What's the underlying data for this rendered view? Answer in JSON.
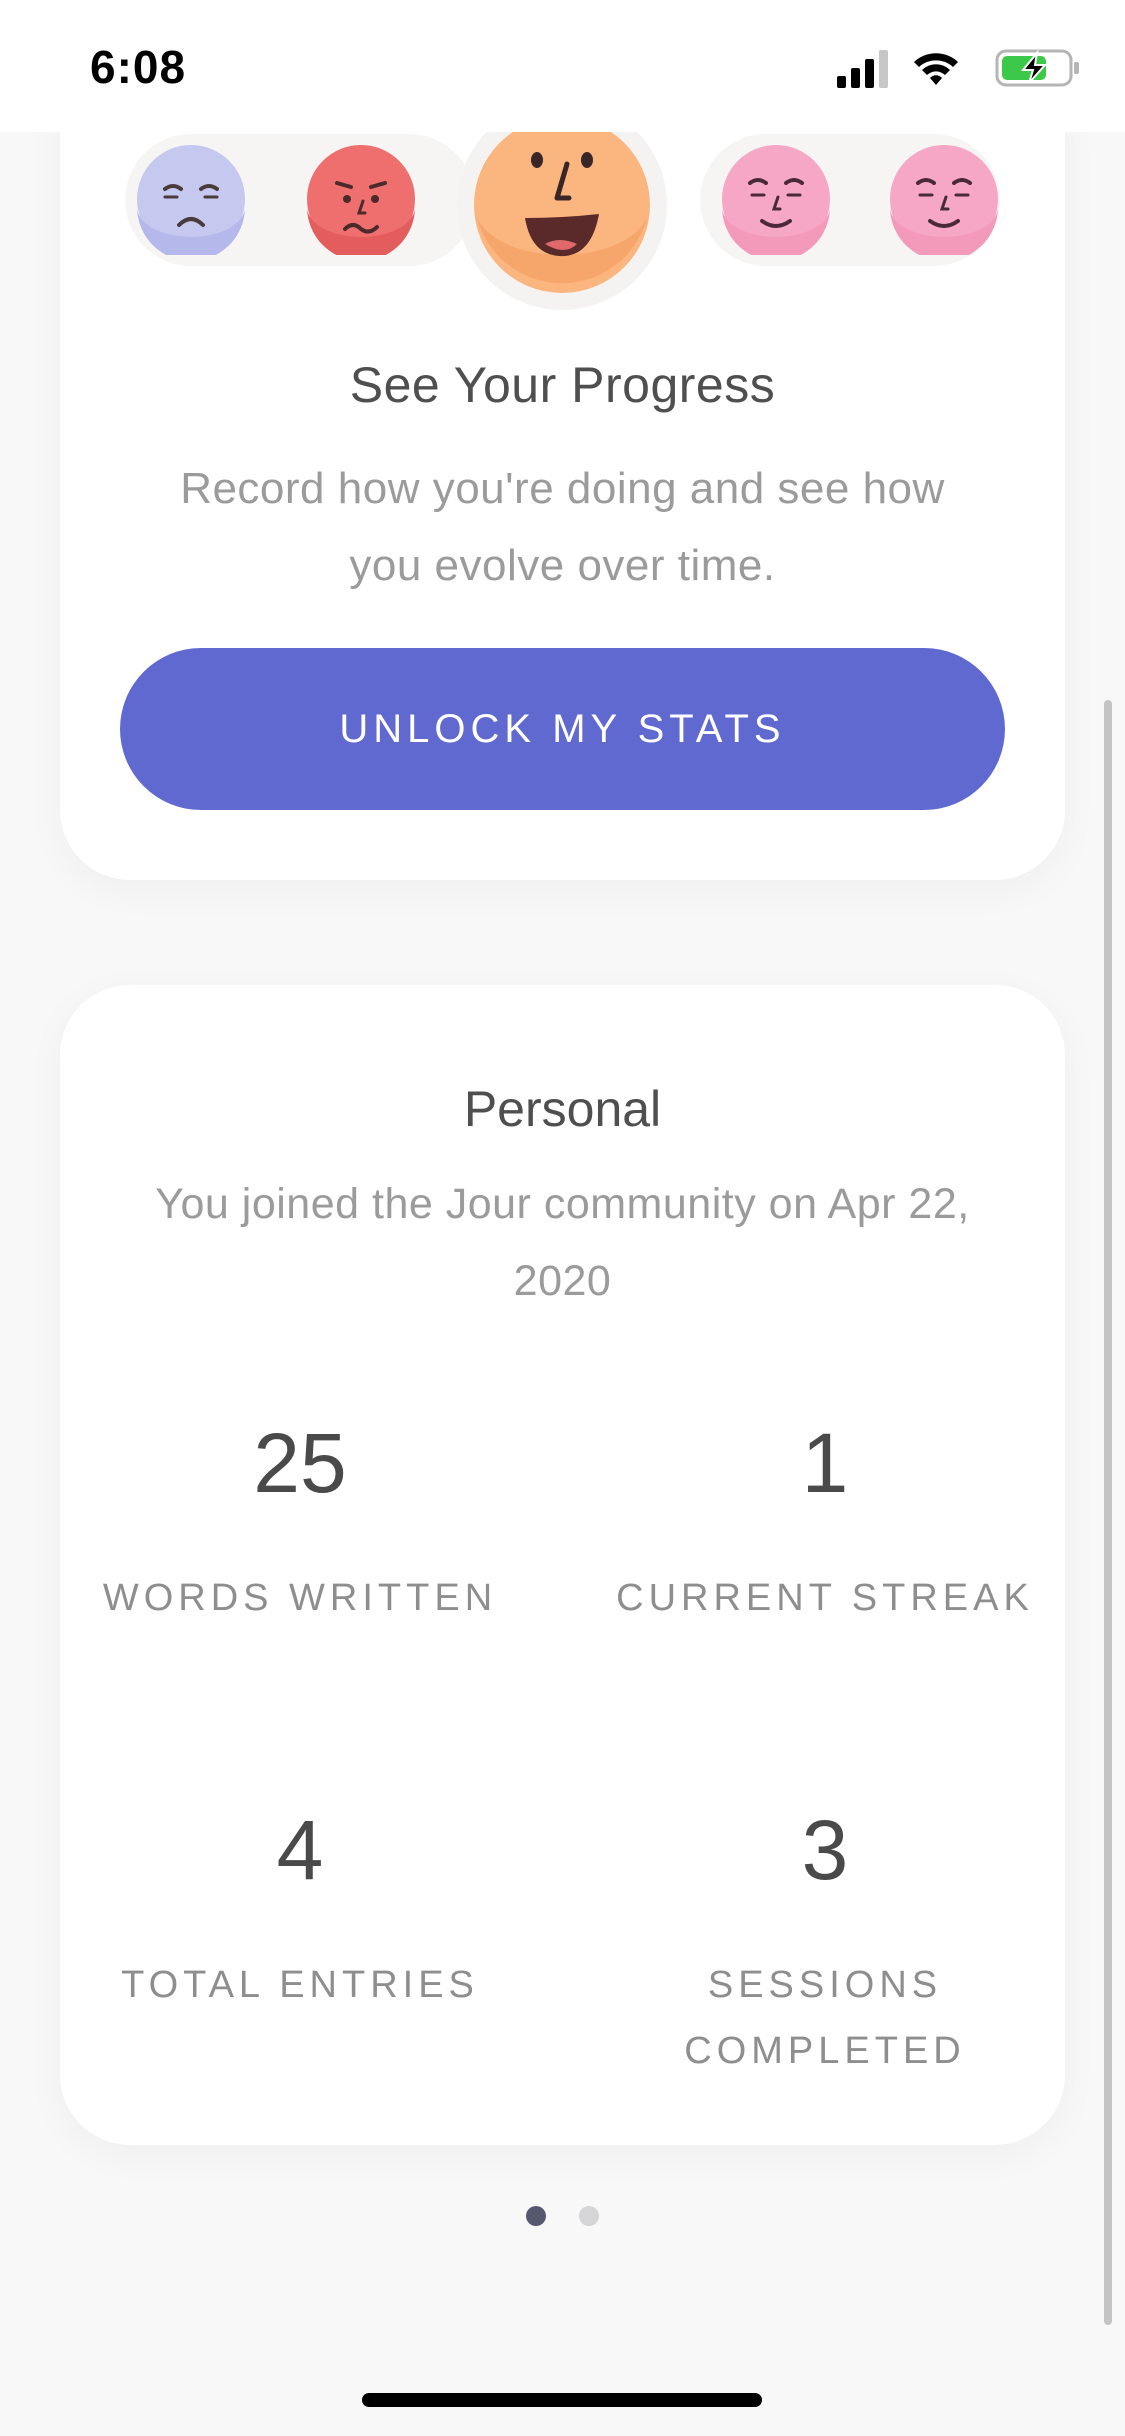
{
  "status_bar": {
    "time": "6:08",
    "icons": [
      "signal-icon",
      "wifi-icon",
      "battery-charging-icon"
    ],
    "battery_color": "#3cc94a"
  },
  "mood_selector": {
    "faces": [
      {
        "name": "sad-face-icon",
        "color": "#c5c8ef"
      },
      {
        "name": "worried-face-icon",
        "color": "#ef6f6f"
      },
      {
        "name": "happy-face-icon",
        "color": "#fbb57f",
        "selected": true
      },
      {
        "name": "calm-face-icon",
        "color": "#f7a7c6"
      },
      {
        "name": "content-face-icon",
        "color": "#f7a7c6"
      }
    ]
  },
  "progress_card": {
    "title": "See Your Progress",
    "description": "Record how you're doing and see how you evolve over time.",
    "button_label": "UNLOCK MY STATS",
    "button_color": "#6069d0"
  },
  "personal_card": {
    "title": "Personal",
    "description": "You joined the Jour community on Apr 22, 2020",
    "stats": [
      {
        "value": "25",
        "label": "WORDS WRITTEN"
      },
      {
        "value": "1",
        "label": "CURRENT STREAK"
      },
      {
        "value": "4",
        "label": "TOTAL ENTRIES"
      },
      {
        "value": "3",
        "label": "SESSIONS COMPLETED"
      }
    ]
  },
  "pagination": {
    "page_count": 2,
    "active_page": 1
  }
}
